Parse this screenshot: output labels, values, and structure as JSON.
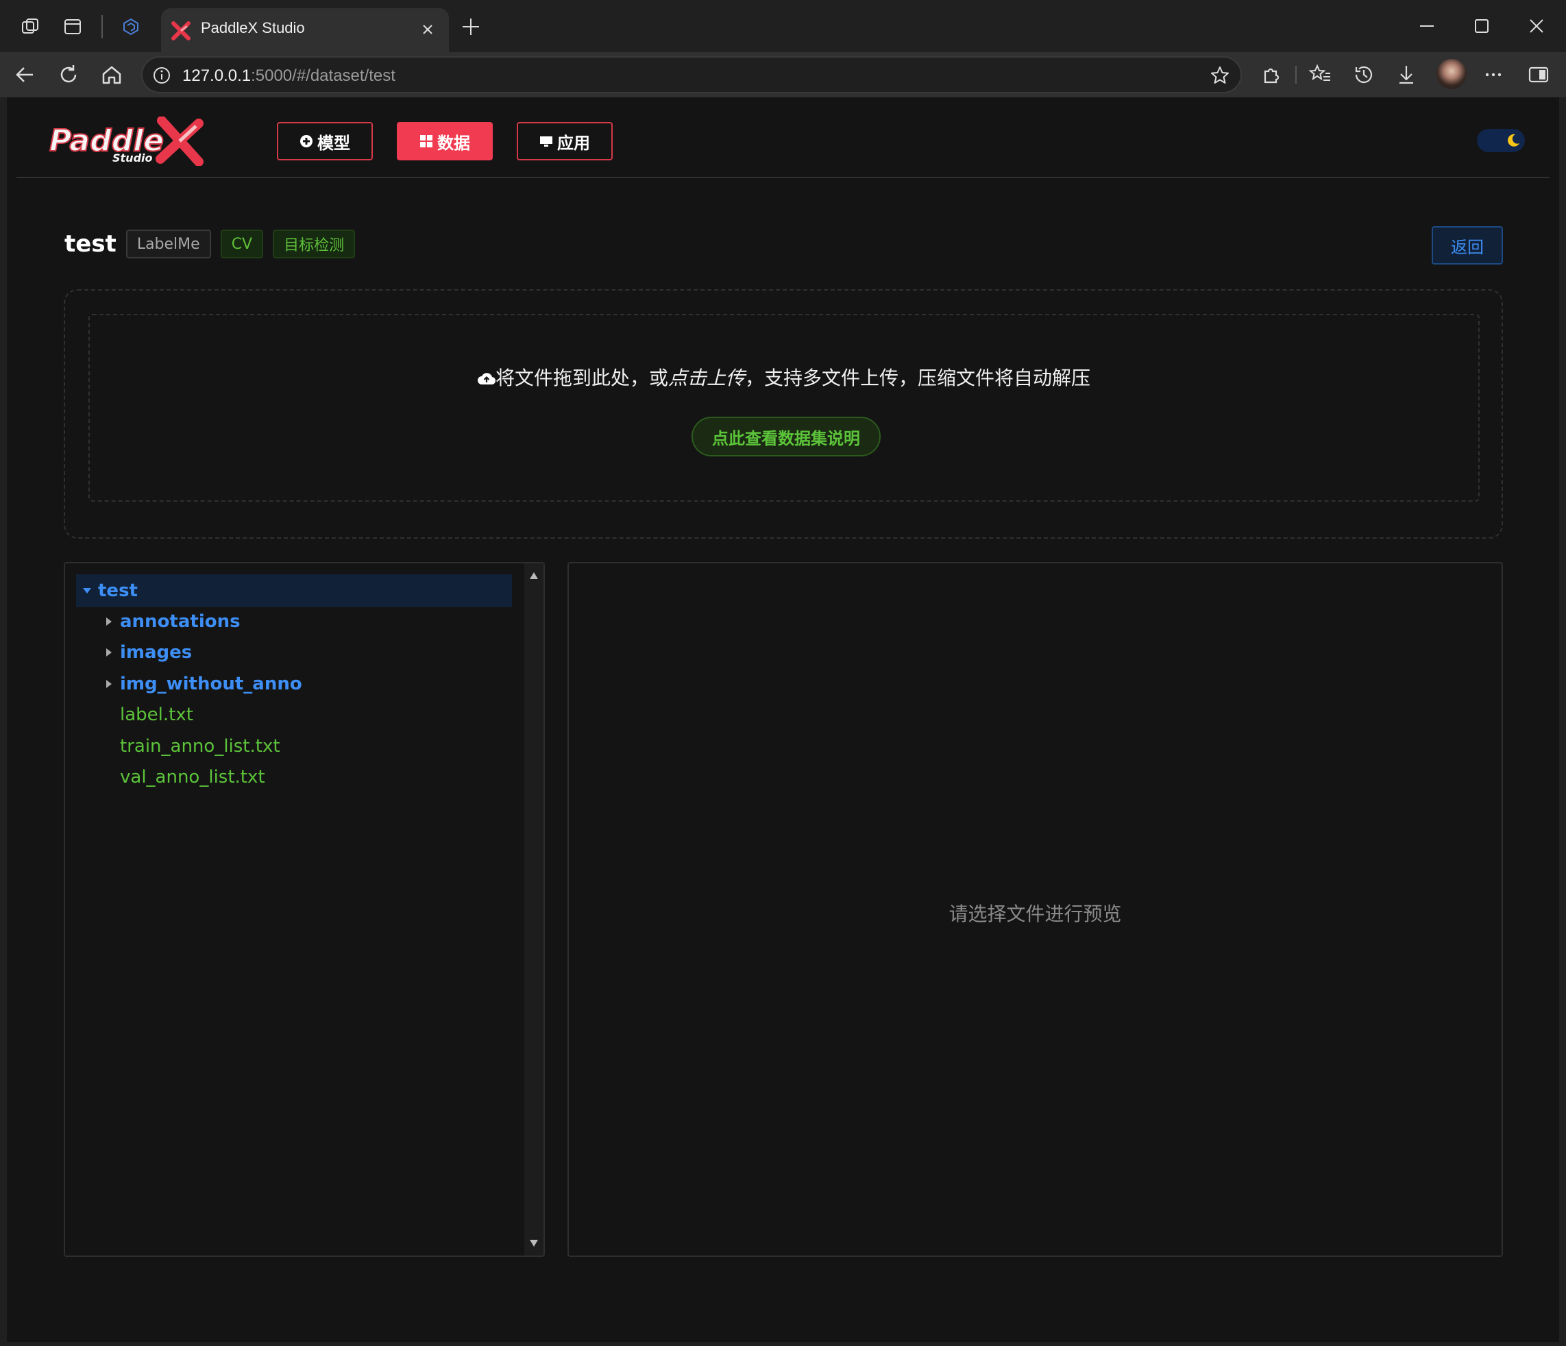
{
  "browser": {
    "tab_title": "PaddleX Studio",
    "url_host": "127.0.0.1",
    "url_path": ":5000/#/dataset/test"
  },
  "header": {
    "nav": [
      {
        "label": "模型",
        "icon": "model-icon",
        "active": false
      },
      {
        "label": "数据",
        "icon": "data-grid-icon",
        "active": true
      },
      {
        "label": "应用",
        "icon": "monitor-icon",
        "active": false
      }
    ],
    "theme_toggle": "moon-icon"
  },
  "dataset": {
    "name": "test",
    "tags": [
      "LabelMe",
      "CV",
      "目标检测"
    ],
    "back_label": "返回"
  },
  "upload": {
    "text_before": "将文件拖到此处，或",
    "text_link": "点击上传",
    "text_after": "，支持多文件上传，压缩文件将自动解压",
    "guide_label": "点此查看数据集说明"
  },
  "tree": {
    "root": "test",
    "folders": [
      "annotations",
      "images",
      "img_without_anno"
    ],
    "files": [
      "label.txt",
      "train_anno_list.txt",
      "val_anno_list.txt"
    ]
  },
  "preview": {
    "placeholder": "请选择文件进行预览"
  },
  "colors": {
    "accent_red": "#f13b50",
    "folder_blue": "#3d8ef5",
    "file_green": "#5cc43a"
  }
}
